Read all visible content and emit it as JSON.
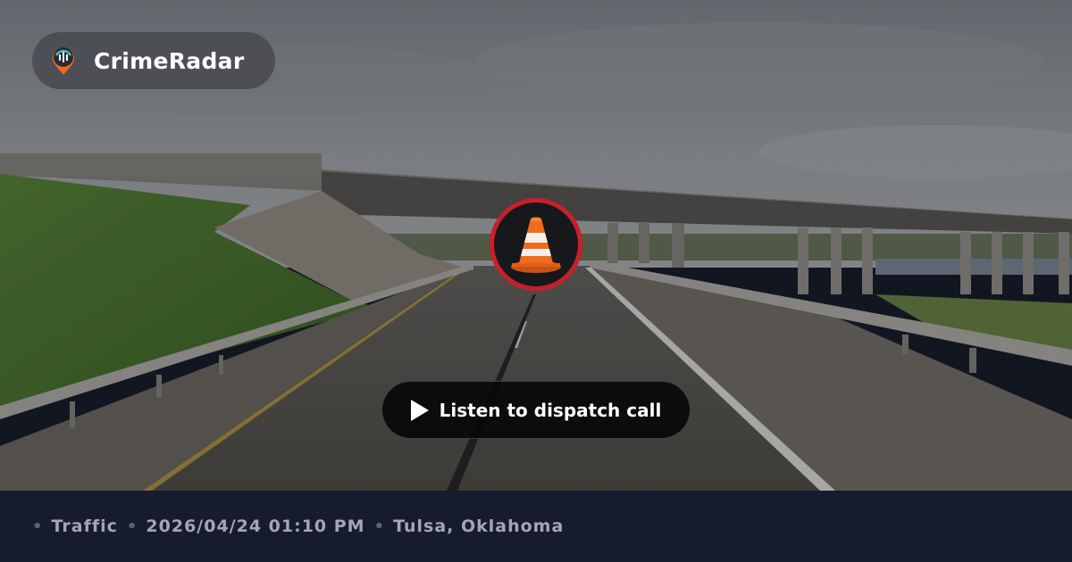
{
  "brand": {
    "name": "CrimeRadar",
    "logo_icon": "radar-pin-icon"
  },
  "incident": {
    "category_icon": "traffic-cone-icon",
    "ring_color": "#c8202a"
  },
  "listen_button": {
    "label": "Listen to dispatch call",
    "icon": "play-icon"
  },
  "footer": {
    "category": "Traffic",
    "datetime": "2026/04/24 01:10 PM",
    "location": "Tulsa, Oklahoma"
  },
  "colors": {
    "footer_bg": "#161c2e",
    "meta_text": "#a3a7b2",
    "cone": "#f26a1b"
  }
}
